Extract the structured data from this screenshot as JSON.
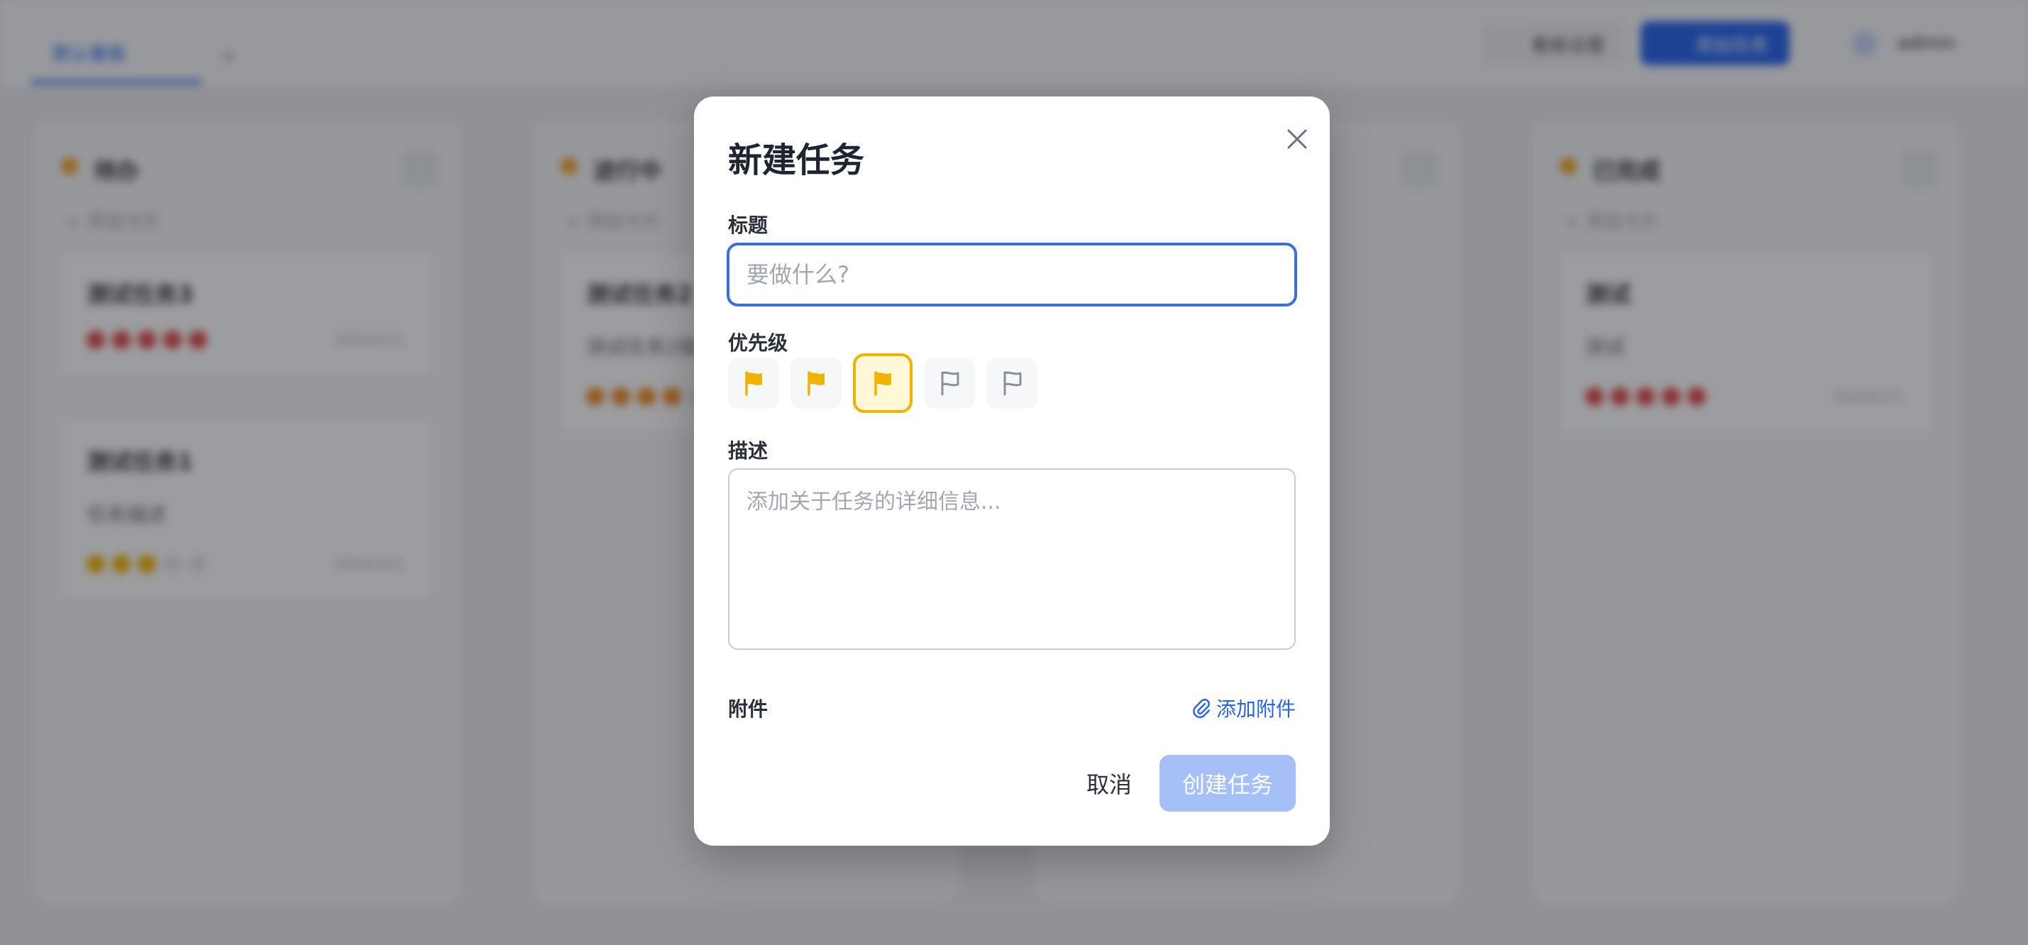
{
  "board": {
    "tab_label": "默认看板",
    "tab_add": "+",
    "manage_label": "看板设置",
    "add_task_label": "添加任务",
    "user_name": "admin",
    "add_card_label": "添加卡片",
    "columns": [
      {
        "title": "待办",
        "cards": [
          {
            "title": "测试任务3",
            "desc": "",
            "star_color": "#e04848",
            "date": "2024/2/1"
          },
          {
            "title": "测试任务1",
            "desc": "任务描述",
            "star_color": "#f0b400",
            "date": "2024/2/1"
          }
        ]
      },
      {
        "title": "进行中",
        "cards": [
          {
            "title": "测试任务2",
            "desc": "测试任务2描述",
            "star_color": "#f08a24",
            "date": ""
          }
        ]
      },
      {
        "title": "",
        "cards": []
      },
      {
        "title": "已完成",
        "cards": [
          {
            "title": "测试",
            "desc": "测试",
            "star_color": "#e04848",
            "date": "2024/2/1"
          }
        ]
      }
    ]
  },
  "modal": {
    "title": "新建任务",
    "title_label": "标题",
    "title_placeholder": "要做什么?",
    "priority_label": "优先级",
    "priorities": [
      {
        "level": 1,
        "icon": "flag-filled-icon",
        "selected": false
      },
      {
        "level": 2,
        "icon": "flag-filled-icon",
        "selected": false
      },
      {
        "level": 3,
        "icon": "flag-filled-icon",
        "selected": true
      },
      {
        "level": 4,
        "icon": "flag-outline-icon",
        "selected": false
      },
      {
        "level": 5,
        "icon": "flag-outline-icon",
        "selected": false
      }
    ],
    "description_label": "描述",
    "description_placeholder": "添加关于任务的详细信息...",
    "attachments_label": "附件",
    "add_attachment_label": "添加附件",
    "cancel_label": "取消",
    "create_label": "创建任务"
  },
  "colors": {
    "accent": "#2563eb",
    "flag": "#f0b400",
    "create_disabled": "#a6c0f7"
  }
}
